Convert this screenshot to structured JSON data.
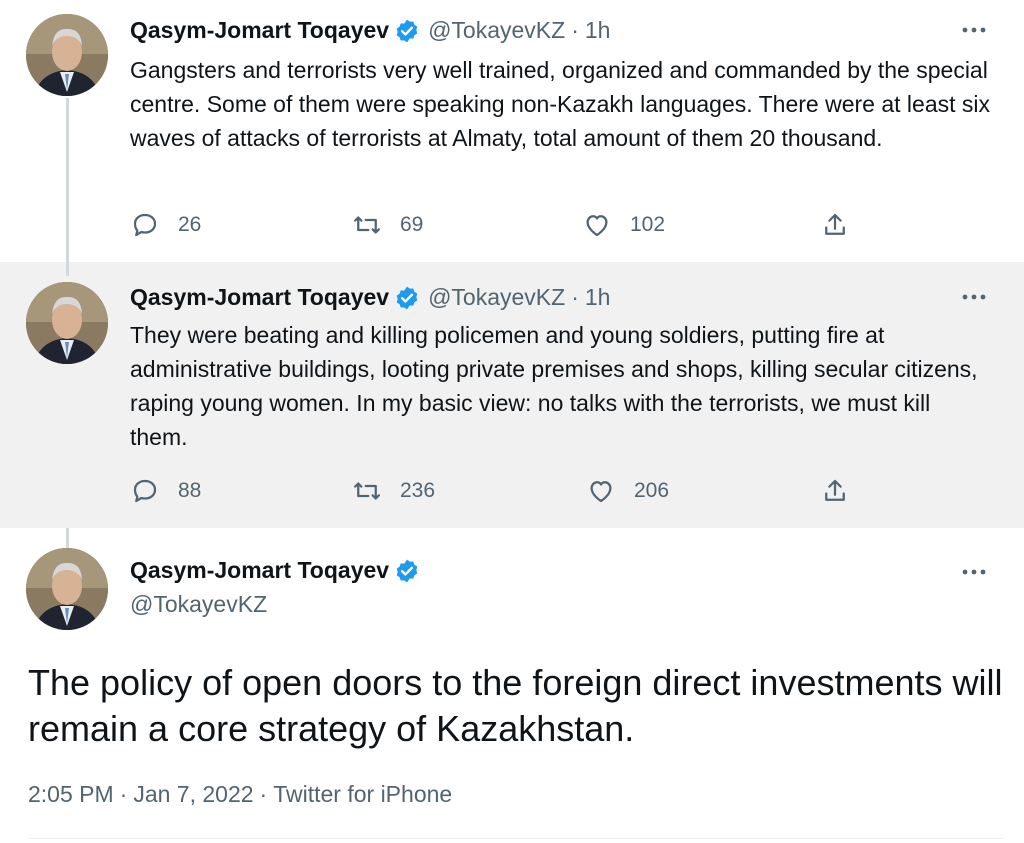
{
  "tweets": [
    {
      "name": "Qasym-Jomart Toqayev",
      "handle": "@TokayevKZ",
      "time": "1h",
      "text": "Gangsters and terrorists very well trained, organized and commanded by the special centre. Some of them were speaking non-Kazakh languages. There were at least six waves of attacks of terrorists at Almaty, total amount of them 20 thousand.",
      "replies": "26",
      "retweets": "69",
      "likes": "102"
    },
    {
      "name": "Qasym-Jomart Toqayev",
      "handle": "@TokayevKZ",
      "time": "1h",
      "text": "They were beating and killing policemen and young soldiers, putting fire at administrative buildings, looting private premises and shops, killing secular citizens, raping young women. In my basic view: no talks with the terrorists, we must kill them.",
      "replies": "88",
      "retweets": "236",
      "likes": "206"
    }
  ],
  "main": {
    "name": "Qasym-Jomart Toqayev",
    "handle": "@TokayevKZ",
    "text": "The policy of open doors to the foreign direct investments will remain a core strategy of Kazakhstan.",
    "time": "2:05 PM",
    "date": "Jan 7, 2022",
    "source": "Twitter for iPhone",
    "separator": "·"
  },
  "colors": {
    "verified": "#1d9bf0",
    "secondary_text": "#536471",
    "highlight_bg": "#f1f1f1"
  },
  "icons": [
    "verified-badge-icon",
    "more-icon",
    "reply-icon",
    "retweet-icon",
    "like-icon",
    "share-icon"
  ]
}
